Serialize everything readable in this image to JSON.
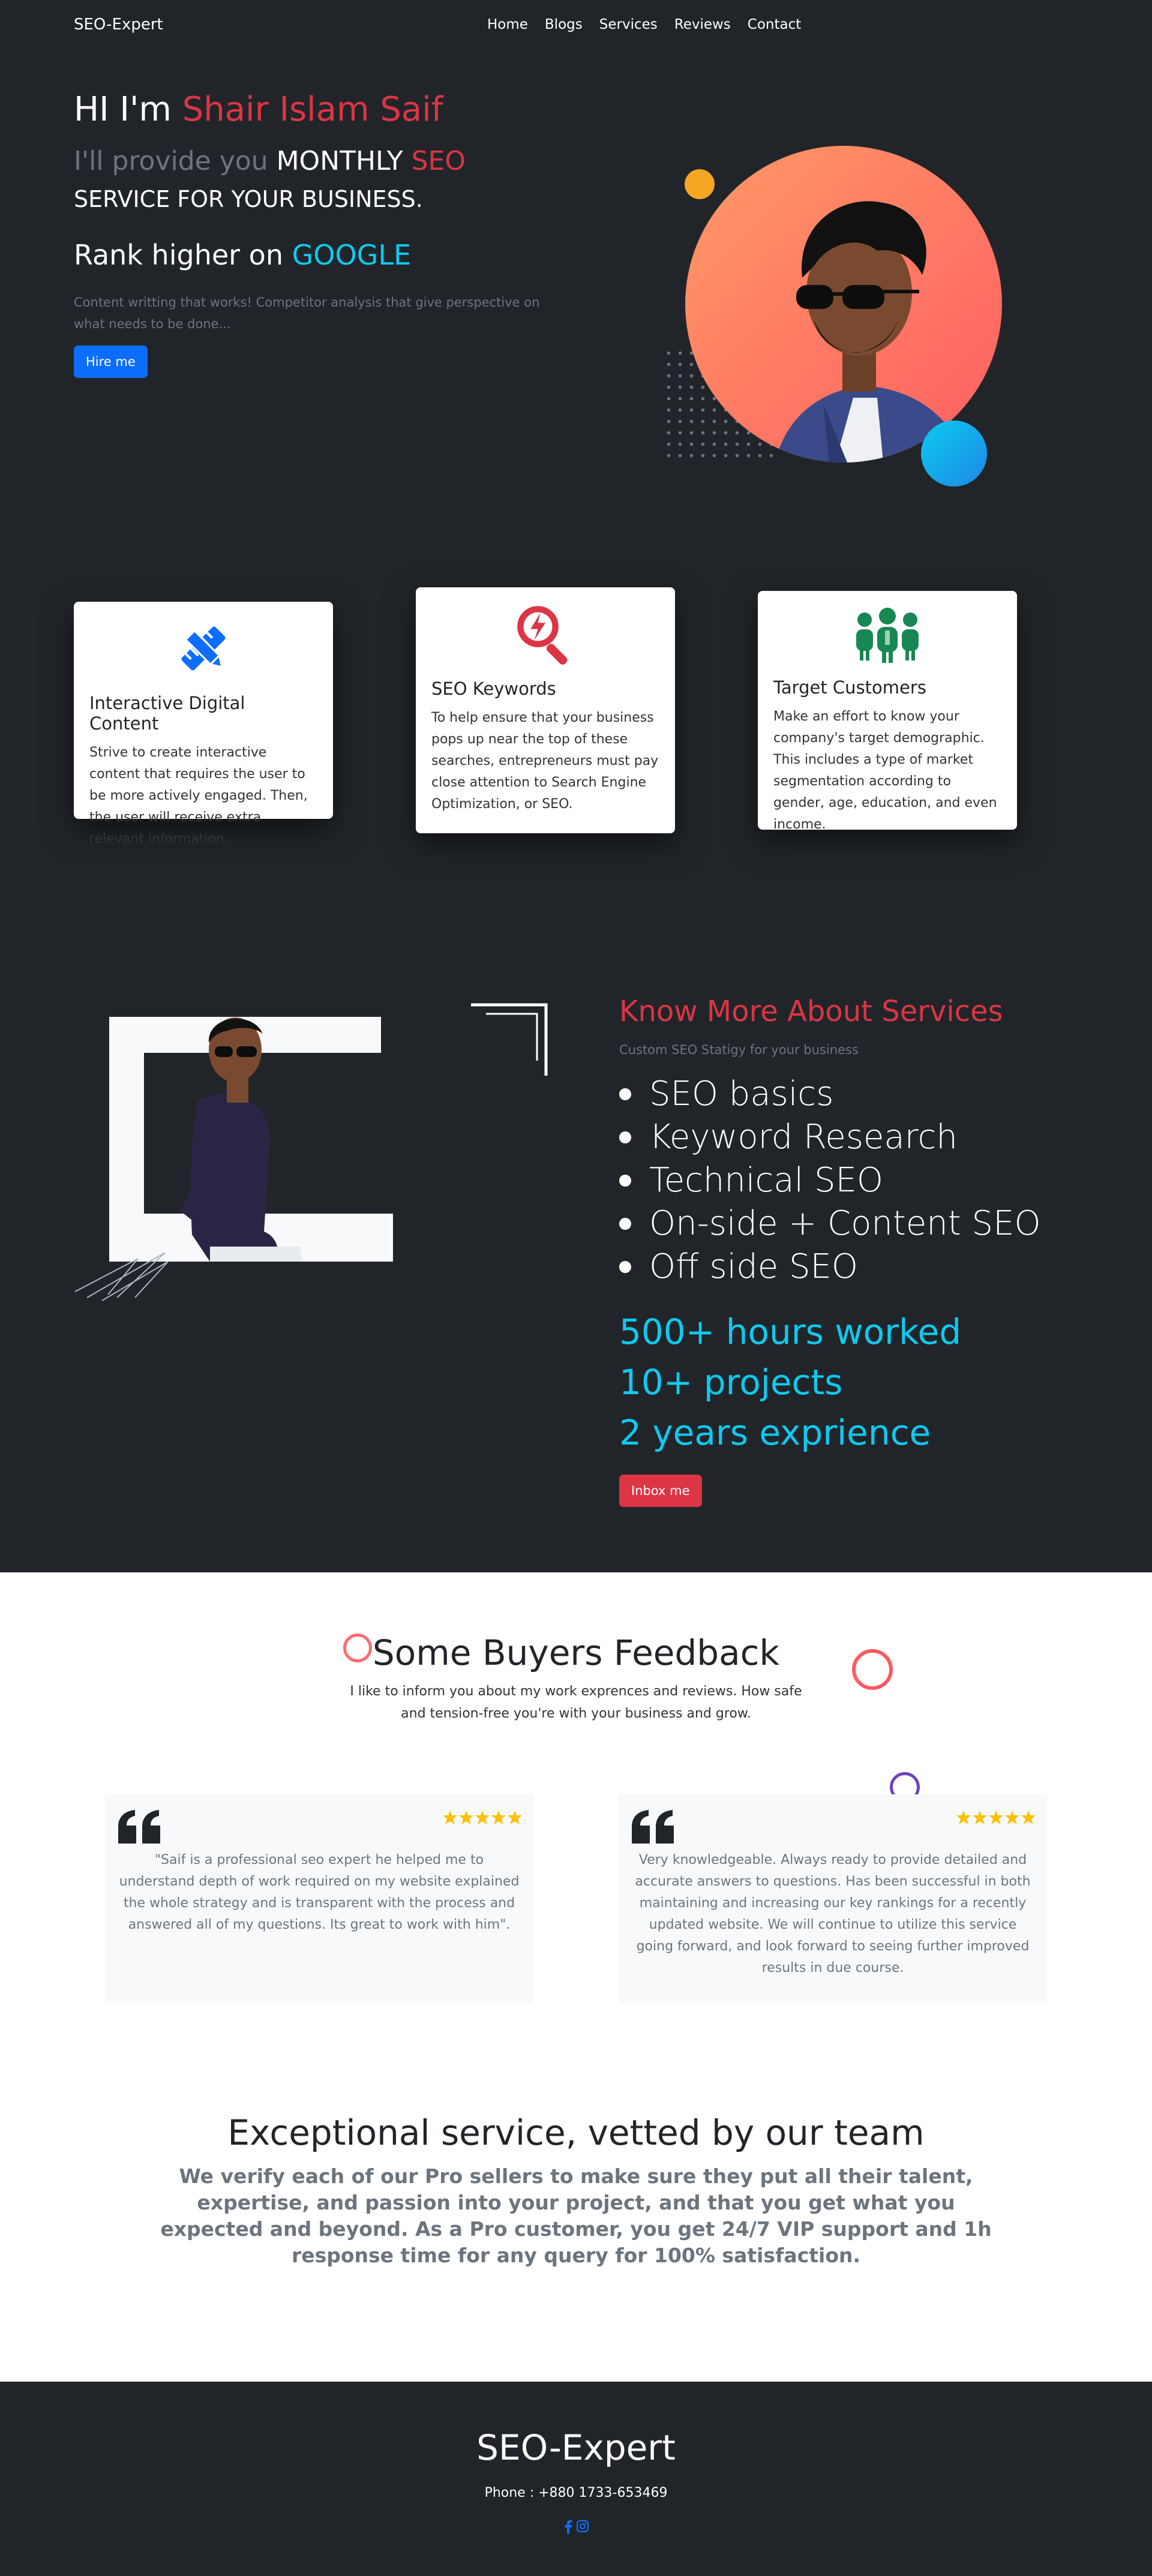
{
  "nav": {
    "brand": "SEO-Expert",
    "links": [
      "Home",
      "Blogs",
      "Services",
      "Reviews",
      "Contact"
    ]
  },
  "hero": {
    "greeting": "HI I'm",
    "name": "Shair Islam Saif",
    "provide_prefix": "I'll provide you",
    "provide_monthly": "MONTHLY",
    "provide_seo": "SEO",
    "service_line": "SERVICE FOR YOUR BUSINESS.",
    "rank_prefix": "Rank higher on",
    "rank_google": "GOOGLE",
    "description": "Content writting that works! Competitor analysis that give perspective on what needs to be done...",
    "button": "Hire me"
  },
  "cards": [
    {
      "icon": "pencil-ruler-icon",
      "title": "Interactive Digital Content",
      "text": "Strive to create interactive content that requires the user to be more actively engaged. Then, the user will receive extra relevant information."
    },
    {
      "icon": "search-bolt-icon",
      "title": "SEO Keywords",
      "text": "To help ensure that your business pops up near the top of these searches, entrepreneurs must pay close attention to Search Engine Optimization, or SEO."
    },
    {
      "icon": "people-group-icon",
      "title": "Target Customers",
      "text": "Make an effort to know your company's target demographic. This includes a type of market segmentation according to gender, age, education, and even income."
    }
  ],
  "services": {
    "title": "Know More About Services",
    "subtitle": "Custom SEO Statigy for your business",
    "items": [
      "SEO basics",
      "Keyword Research",
      "Technical SEO",
      "On-side + Content SEO",
      "Off side SEO"
    ],
    "stats": [
      "500+ hours worked",
      "10+ projects",
      "2 years exprience"
    ],
    "button": "Inbox me"
  },
  "feedback": {
    "title": "Some Buyers Feedback",
    "subtitle": "I like to inform you about my work exprences and reviews. How safe and tension-free you're with your business and grow.",
    "reviews": [
      {
        "text": "\"Saif is a professional seo expert he helped me to understand depth of work required on my website explained the whole strategy and is transparent with the process and answered all of my questions. Its great to work with him\".",
        "stars": 5
      },
      {
        "text": "Very knowledgeable. Always ready to provide detailed and accurate answers to questions. Has been successful in both maintaining and increasing our key rankings for a recently updated website. We will continue to utilize this service going forward, and look forward to seeing further improved results in due course.",
        "stars": 5
      }
    ]
  },
  "exceptional": {
    "title": "Exceptional service, vetted by our team",
    "text": "We verify each of our Pro sellers to make sure they put all their talent, expertise, and passion into your project, and that you get what you expected and beyond. As a Pro customer, you get 24/7 VIP support and 1h response time for any query for 100% satisfaction."
  },
  "footer": {
    "brand": "SEO-Expert",
    "phone": "Phone : +880 1733-653469",
    "social": [
      "facebook-icon",
      "instagram-icon"
    ]
  },
  "colors": {
    "dark": "#212529",
    "red": "#dc3545",
    "cyan": "#0dcaf0",
    "blue": "#0d6efd",
    "green": "#198754",
    "star": "#ffc107"
  }
}
